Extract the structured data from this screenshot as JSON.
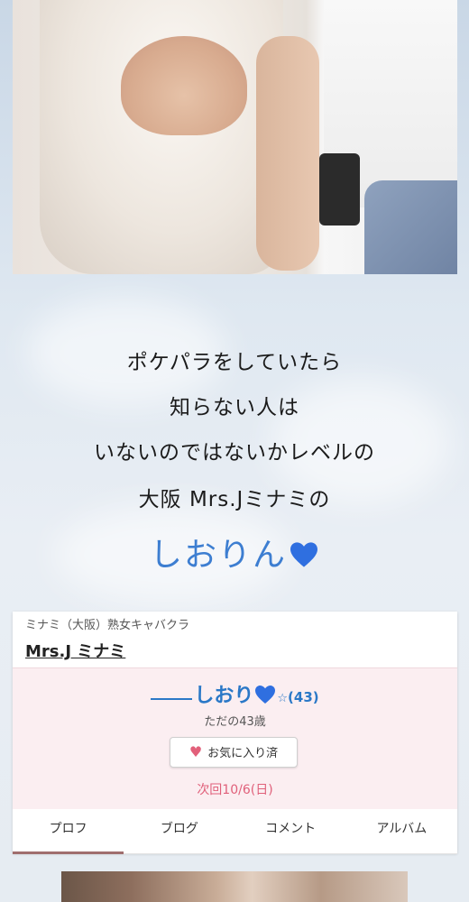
{
  "intro": {
    "lines": [
      "ポケパラをしていたら",
      "知らない人は",
      "いないのではないかレベルの",
      "大阪 Mrs.Jミナミの"
    ],
    "name": "しおりん"
  },
  "card": {
    "shop_sub": "ミナミ（大阪）熟女キャバクラ",
    "shop_name": "Mrs.J ミナミ",
    "girl_name": "しおり",
    "girl_age": "(43)",
    "age_caption": "ただの43歳",
    "favorite_label": "お気に入り済",
    "next_shift": "次回10/6(日)"
  },
  "tabs": [
    "プロフ",
    "ブログ",
    "コメント",
    "アルバム"
  ],
  "colors": {
    "accent_blue": "#2a78c7",
    "pink_bg": "#fbeef1",
    "heart_pink": "#e2607a"
  }
}
